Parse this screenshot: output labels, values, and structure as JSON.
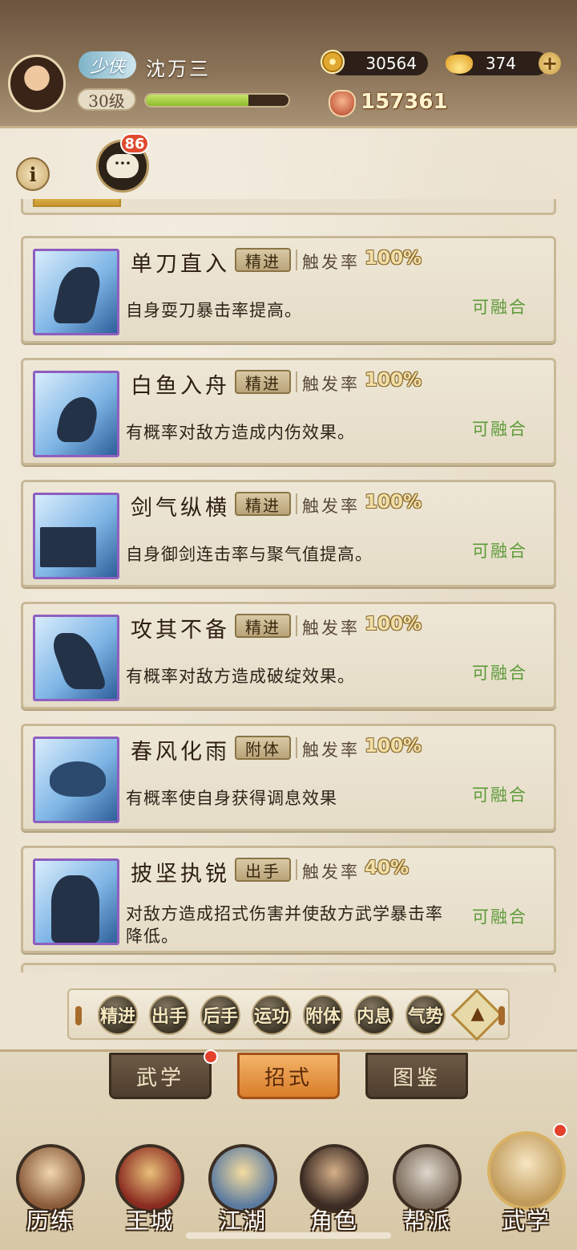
{
  "header": {
    "title_badge": "少侠",
    "player_name": "沈万三",
    "level": "30级",
    "exp_progress": 0.72,
    "coins": "30564",
    "ingots": "374",
    "power": "157361",
    "chat_badge": "86"
  },
  "skills": [
    {
      "name": "单刀直入",
      "type": "精进",
      "trigger_label": "触发率",
      "trigger_value": "100%",
      "desc": "自身耍刀暴击率提高。",
      "status": "可融合"
    },
    {
      "name": "白鱼入舟",
      "type": "精进",
      "trigger_label": "触发率",
      "trigger_value": "100%",
      "desc": "有概率对敌方造成内伤效果。",
      "status": "可融合"
    },
    {
      "name": "剑气纵横",
      "type": "精进",
      "trigger_label": "触发率",
      "trigger_value": "100%",
      "desc": "自身御剑连击率与聚气值提高。",
      "status": "可融合"
    },
    {
      "name": "攻其不备",
      "type": "精进",
      "trigger_label": "触发率",
      "trigger_value": "100%",
      "desc": "有概率对敌方造成破绽效果。",
      "status": "可融合"
    },
    {
      "name": "春风化雨",
      "type": "附体",
      "trigger_label": "触发率",
      "trigger_value": "100%",
      "desc": "有概率使自身获得调息效果",
      "status": "可融合"
    },
    {
      "name": "披坚执锐",
      "type": "出手",
      "trigger_label": "触发率",
      "trigger_value": "40%",
      "desc": "对敌方造成招式伤害并使敌方武学暴击率降低。",
      "status": "可融合"
    }
  ],
  "filters": [
    "精进",
    "出手",
    "后手",
    "运功",
    "附体",
    "内息",
    "气势"
  ],
  "sub_tabs": {
    "wuxue": "武学",
    "zhaoshi": "招式",
    "tujian": "图鉴"
  },
  "nav": {
    "lilian": "历练",
    "wangcheng": "王城",
    "jianghu": "江湖",
    "juese": "角色",
    "bangpai": "帮派",
    "wuxue": "武学"
  },
  "colors": {
    "fuse_green": "#5e9a3a",
    "rarity_purple": "#8d5fc0",
    "active_tab": "#e89a48",
    "red_dot": "#e3412c"
  }
}
